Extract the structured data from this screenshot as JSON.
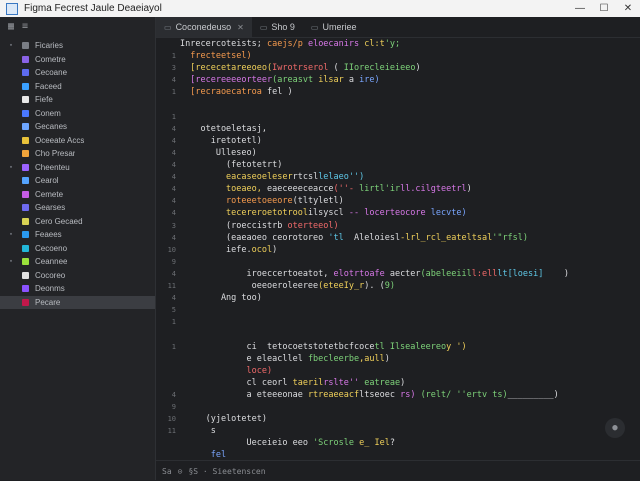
{
  "window": {
    "title": "Figma  Fecrest  Jaule Deaeiayol",
    "controls": [
      "—",
      "☐",
      "✕"
    ]
  },
  "sidebar": {
    "header_icons": [
      "grid-icon",
      "sort-icon",
      "more-icon"
    ],
    "items": [
      {
        "label": "Ficaries",
        "color": "#7a7e85"
      },
      {
        "label": "Cometre",
        "color": "#8a63e6"
      },
      {
        "label": "Cecoane",
        "color": "#5d6bf0"
      },
      {
        "label": "Faceed",
        "color": "#3aa0ff"
      },
      {
        "label": "Fiefe",
        "color": "#e8e8e8"
      },
      {
        "label": "Conem",
        "color": "#4a78ff"
      },
      {
        "label": "Gecanes",
        "color": "#6ea6ff"
      },
      {
        "label": "Oceeate Accs",
        "color": "#e8c23a"
      },
      {
        "label": "Cho Presar",
        "color": "#f2a53b"
      },
      {
        "label": "Cheenteu",
        "color": "#9b62ff"
      },
      {
        "label": "Cearol",
        "color": "#55a4ff"
      },
      {
        "label": "Cemete",
        "color": "#c65ce6"
      },
      {
        "label": "Gearses",
        "color": "#6e6af0"
      },
      {
        "label": "Cero Gecaed",
        "color": "#d8d354"
      },
      {
        "label": "Feaees",
        "color": "#2a9af0"
      },
      {
        "label": "Cecoeno",
        "color": "#22b7d8"
      },
      {
        "label": "Ceannee",
        "color": "#9be23b"
      },
      {
        "label": "Cocoreo",
        "color": "#e1e1e1"
      },
      {
        "label": "Deonms",
        "color": "#8a52ff"
      },
      {
        "label": "Pecare",
        "color": "#c2184b"
      }
    ],
    "selected_index": 19
  },
  "tabs": [
    {
      "label": "Coconedeuso",
      "active": true
    },
    {
      "label": "Sho 9",
      "active": false
    },
    {
      "label": "Umeriee",
      "active": false
    }
  ],
  "code_lines": [
    {
      "n": "",
      "segs": [
        [
          "w",
          "Inrecercoteists; "
        ],
        [
          "o",
          "caejs/p "
        ],
        [
          "p",
          "eloecanirs "
        ],
        [
          "y",
          "cl:t"
        ],
        [
          "g",
          "'y;"
        ]
      ]
    },
    {
      "n": "1",
      "segs": [
        [
          "o",
          "  frecteetsel)"
        ]
      ]
    },
    {
      "n": "3",
      "segs": [
        [
          "y",
          "  [rececetareeoeo("
        ],
        [
          "r",
          "Iwrotrserol "
        ],
        [
          "w",
          "( "
        ],
        [
          "g",
          "IIorecleieieeo"
        ],
        [
          "w",
          ")"
        ]
      ]
    },
    {
      "n": "4",
      "segs": [
        [
          "p",
          "  [recereeeeorteer"
        ],
        [
          "g",
          "(areasvt "
        ],
        [
          "y",
          "ilsar "
        ],
        [
          "w",
          "a"
        ],
        [
          "b",
          " ire)"
        ]
      ]
    },
    {
      "n": "1",
      "segs": [
        [
          "o",
          "  [recraoecatroa "
        ],
        [
          "w",
          "fel )"
        ]
      ]
    },
    {
      "n": "",
      "segs": []
    },
    {
      "n": "1",
      "segs": []
    },
    {
      "n": "4",
      "segs": [
        [
          "w",
          "    otetoeletasj,"
        ]
      ]
    },
    {
      "n": "4",
      "segs": [
        [
          "w",
          "      iretotetl)"
        ]
      ]
    },
    {
      "n": "4",
      "segs": [
        [
          "w",
          "       Ulleseo)"
        ]
      ]
    },
    {
      "n": "4",
      "segs": [
        [
          "w",
          "         (fetotetrt)"
        ]
      ]
    },
    {
      "n": "4",
      "segs": [
        [
          "y",
          "         eacaseoeleser"
        ],
        [
          "w",
          "rtcsl"
        ],
        [
          "c",
          "lelaeo'')"
        ]
      ]
    },
    {
      "n": "4",
      "segs": [
        [
          "y",
          "         toeaeo, "
        ],
        [
          "w",
          "eaeceeeceacce"
        ],
        [
          "r",
          "(''- "
        ],
        [
          "g",
          "lirtl'ir"
        ],
        [
          "p",
          "ll.cilgteetrl"
        ],
        [
          "w",
          ")"
        ]
      ]
    },
    {
      "n": "4",
      "segs": [
        [
          "o",
          "         roteeetoeeore"
        ],
        [
          "w",
          "(tltyletl)"
        ]
      ]
    },
    {
      "n": "4",
      "segs": [
        [
          "y",
          "         tecereroetotrool"
        ],
        [
          "w",
          "ilsyscl "
        ],
        [
          "p",
          "-- locerteocore "
        ],
        [
          "b",
          "lecvte)"
        ]
      ]
    },
    {
      "n": "3",
      "segs": [
        [
          "w",
          "         (roeccistrb "
        ],
        [
          "r",
          "oterteeol)"
        ]
      ]
    },
    {
      "n": "4",
      "segs": [
        [
          "w",
          "         (eaeaoeo ceorotoreo"
        ],
        [
          "c",
          " 'tl"
        ],
        [
          "w",
          "  Aleloiesl"
        ],
        [
          "y",
          "-lrl_rcl_eateltsal"
        ],
        [
          "g",
          "'\"rfsl)"
        ]
      ]
    },
    {
      "n": "10",
      "segs": [
        [
          "w",
          "         iefe."
        ],
        [
          "y",
          "ocol"
        ],
        [
          "w",
          ")"
        ]
      ]
    },
    {
      "n": "9",
      "segs": []
    },
    {
      "n": "4",
      "segs": [
        [
          "w",
          "             iroeccertoeatot, "
        ],
        [
          "p",
          "elotrtoafe "
        ],
        [
          "w",
          "aecter"
        ],
        [
          "g",
          "(abeleeiil"
        ],
        [
          "r",
          "l:ell"
        ],
        [
          "c",
          "lt[loesi]  "
        ],
        [
          "w",
          "  )"
        ]
      ]
    },
    {
      "n": "11",
      "segs": [
        [
          "w",
          "              oeeoeroleeree"
        ],
        [
          "y",
          "(eteeIy_r"
        ],
        [
          "w",
          "). ("
        ],
        [
          "g",
          "9)"
        ]
      ]
    },
    {
      "n": "4",
      "segs": [
        [
          "w",
          "        Ang too)"
        ]
      ]
    },
    {
      "n": "5",
      "segs": []
    },
    {
      "n": "1",
      "segs": [
        [
          "b",
          "       "
        ],
        [
          "w",
          ""
        ]
      ]
    },
    {
      "n": "",
      "segs": []
    },
    {
      "n": "1",
      "segs": [
        [
          "w",
          "             ci  tetocoetstotetbcfcoce"
        ],
        [
          "g",
          "tl Ilsealeereo"
        ],
        [
          "y",
          "y ')"
        ]
      ]
    },
    {
      "n": "",
      "segs": [
        [
          "w",
          "             e eleacllel "
        ],
        [
          "g",
          "fbecleerbe"
        ],
        [
          "y",
          ",aull"
        ],
        [
          "w",
          ")"
        ]
      ]
    },
    {
      "n": "",
      "segs": [
        [
          "r",
          "             loce)"
        ]
      ]
    },
    {
      "n": "",
      "segs": [
        [
          "w",
          "             cl ceorl "
        ],
        [
          "y",
          "taeril"
        ],
        [
          "p",
          "rslte'' "
        ],
        [
          "g",
          "eatreae"
        ],
        [
          "w",
          ")"
        ]
      ]
    },
    {
      "n": "4",
      "segs": [
        [
          "w",
          "             a eteeeonae "
        ],
        [
          "y",
          "rtreaeeacf"
        ],
        [
          "w",
          "ltseoec "
        ],
        [
          "p",
          "rs) "
        ],
        [
          "g",
          "(relt/ ''ertv ts)"
        ],
        [
          "w",
          "_________)"
        ]
      ]
    },
    {
      "n": "9",
      "segs": []
    },
    {
      "n": "10",
      "segs": [
        [
          "w",
          "     (yjelotetet)"
        ]
      ]
    },
    {
      "n": "11",
      "segs": [
        [
          "w",
          "      s"
        ]
      ]
    },
    {
      "n": "",
      "segs": [
        [
          "w",
          "             Ueceieio eeo "
        ],
        [
          "g",
          "'Scrosle "
        ],
        [
          "y",
          "e_ Iel"
        ],
        [
          "w",
          "?"
        ]
      ]
    },
    {
      "n": "",
      "segs": [
        [
          "b",
          "      fel"
        ]
      ]
    }
  ],
  "status": {
    "items": [
      "Sa",
      "⊙",
      "§S · Sieetenscen"
    ]
  }
}
